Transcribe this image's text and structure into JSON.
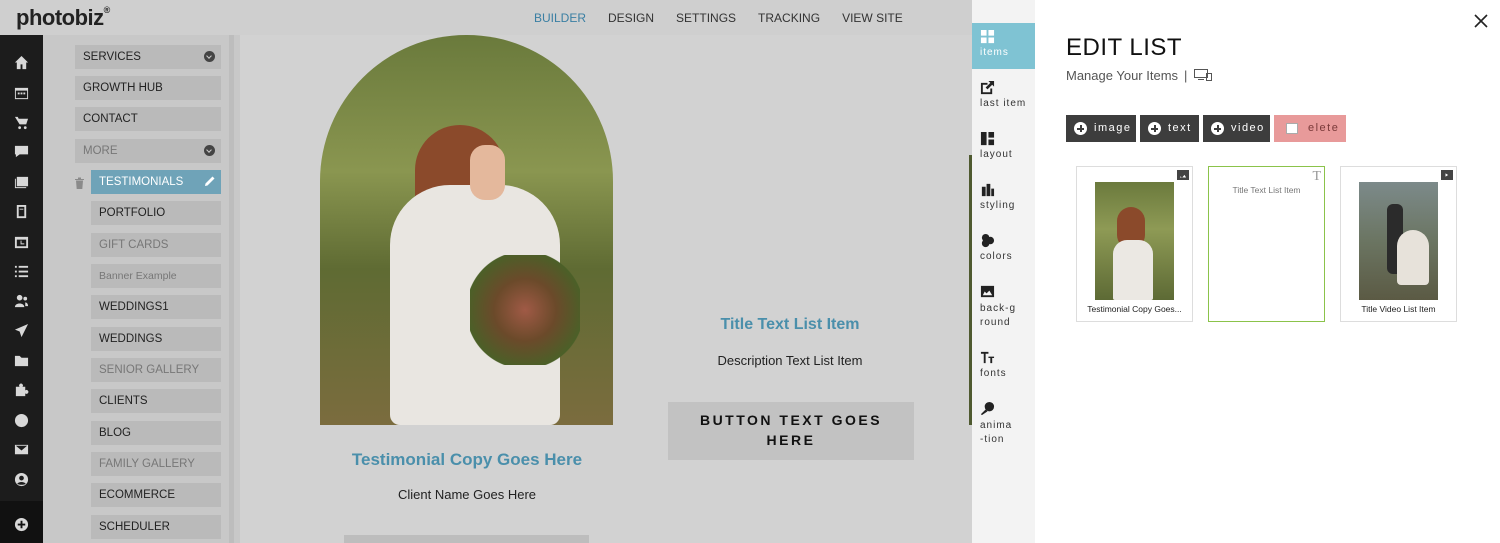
{
  "app": {
    "logo": "photobiz",
    "logo_mark": "®"
  },
  "topnav": {
    "items": [
      "BUILDER",
      "DESIGN",
      "SETTINGS",
      "TRACKING",
      "VIEW SITE"
    ],
    "active": "BUILDER"
  },
  "sidebar_icons": [
    "home-icon",
    "calendar-icon",
    "cart-icon",
    "chat-icon",
    "gallery-icon",
    "book-icon",
    "scheduler-icon",
    "list-icon",
    "users-icon",
    "send-icon",
    "folder-icon",
    "puzzle-icon",
    "globe-icon",
    "mail-icon",
    "account-icon",
    "add-icon"
  ],
  "pages": {
    "items": [
      {
        "label": "SERVICES"
      },
      {
        "label": "GROWTH HUB"
      },
      {
        "label": "CONTACT"
      },
      {
        "label": "MORE"
      },
      {
        "label": "TESTIMONIALS"
      },
      {
        "label": "PORTFOLIO"
      },
      {
        "label": "GIFT CARDS"
      },
      {
        "label": "Banner Example"
      },
      {
        "label": "WEDDINGS1"
      },
      {
        "label": "WEDDINGS"
      },
      {
        "label": "SENIOR GALLERY"
      },
      {
        "label": "CLIENTS"
      },
      {
        "label": "BLOG"
      },
      {
        "label": "FAMILY GALLERY"
      },
      {
        "label": "ECOMMERCE"
      },
      {
        "label": "SCHEDULER"
      }
    ]
  },
  "canvas": {
    "testimonial_copy": "Testimonial Copy Goes Here",
    "client_name": "Client Name Goes Here",
    "title_text": "Title Text List Item",
    "description_text": "Description Text List Item",
    "button_text": "BUTTON TEXT GOES HERE"
  },
  "edit_tabs": [
    {
      "label": "items",
      "icon": "grid-icon"
    },
    {
      "label": "last item",
      "icon": "share-icon"
    },
    {
      "label": "layout",
      "icon": "layout-icon"
    },
    {
      "label": "styling",
      "icon": "brush-icon"
    },
    {
      "label": "colors",
      "icon": "palette-icon"
    },
    {
      "label": "back-ground",
      "icon": "image-icon"
    },
    {
      "label": "fonts",
      "icon": "font-icon"
    },
    {
      "label": "anima-tion",
      "icon": "animation-icon"
    }
  ],
  "edit": {
    "title": "EDIT LIST",
    "subtitle": "Manage Your Items",
    "separator": "|",
    "buttons": {
      "image": "image",
      "text": "text",
      "video": "video",
      "delete": "elete"
    },
    "cards": [
      {
        "caption": "Testimonial Copy Goes...",
        "type_icon": "image-type-icon"
      },
      {
        "caption": "Title Text List Item",
        "type_icon": "text-type-icon",
        "type_glyph": "T"
      },
      {
        "caption": "Title Video List Item",
        "type_icon": "video-type-icon"
      }
    ]
  },
  "colors": {
    "accent": "#7fc3d3",
    "heading_blue": "#4a8fab",
    "selected_border": "#8bc34a",
    "delete_bg": "#e89a9a"
  }
}
